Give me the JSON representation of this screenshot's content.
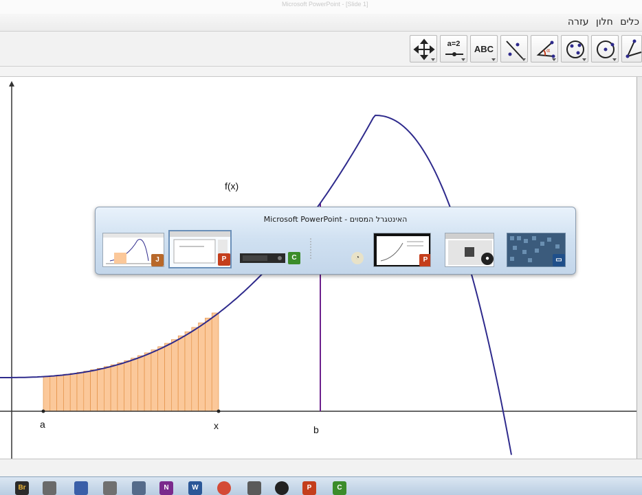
{
  "window": {
    "title": "Microsoft PowerPoint - [Slide 1]"
  },
  "menubar": {
    "items": [
      "כלים",
      "חלון",
      "עזרה"
    ]
  },
  "toolbar": {
    "tools": [
      {
        "name": "move-graphics-view-tool",
        "icon": "move-arrows-icon",
        "text": ""
      },
      {
        "name": "slider-tool",
        "icon": "slider-icon",
        "text": "a=2"
      },
      {
        "name": "text-tool",
        "icon": "text-icon",
        "text": "ABC"
      },
      {
        "name": "reflect-line-tool",
        "icon": "reflect-about-line-icon",
        "text": ""
      },
      {
        "name": "angle-tool",
        "icon": "angle-icon",
        "text": ""
      },
      {
        "name": "conic-tool",
        "icon": "conic-through-points-icon",
        "text": ""
      },
      {
        "name": "circle-tool",
        "icon": "circle-with-center-icon",
        "text": ""
      },
      {
        "name": "polygon-tool",
        "icon": "polygon-icon",
        "text": ""
      }
    ]
  },
  "graph": {
    "function_label": "f(x)",
    "point_labels": {
      "a": "a",
      "x": "x",
      "b": "b"
    },
    "colors": {
      "curve": "#2e2a8c",
      "line_b": "#6b1f8c",
      "bars_fill": "#fbc89a",
      "bars_stroke": "#e08a3c",
      "axis": "#333333"
    },
    "riemann_bar_count": 26
  },
  "task_switcher": {
    "title": "Microsoft PowerPoint - האינטגרל המסוים",
    "windows": [
      {
        "name": "geogebra-window-thumb",
        "badge": "java-icon",
        "selected": false
      },
      {
        "name": "powerpoint-window-thumb",
        "badge": "powerpoint-icon",
        "selected": true
      },
      {
        "name": "camtasia-recorder-thumb",
        "badge": "camtasia-icon",
        "selected": false
      },
      {
        "name": "blank-window-thumb",
        "badge": "",
        "selected": false
      },
      {
        "name": "app-window-thumb",
        "badge": "clock-app-icon",
        "selected": false
      },
      {
        "name": "powerpoint-slide-thumb",
        "badge": "powerpoint-icon",
        "selected": false
      },
      {
        "name": "media-window-thumb",
        "badge": "media-icon",
        "selected": false
      },
      {
        "name": "desktop-thumb",
        "badge": "desktop-icon",
        "selected": false
      }
    ]
  },
  "taskbar": {
    "icons": [
      {
        "name": "bridge-icon",
        "text": "Br",
        "color": "#2b2b2b"
      },
      {
        "name": "paint-app-icon",
        "text": "",
        "color": "#6a6a6a"
      },
      {
        "name": "checkmark-app-icon",
        "text": "",
        "color": "#3a5fa8"
      },
      {
        "name": "gear-app-icon",
        "text": "",
        "color": "#707070"
      },
      {
        "name": "writing-app-icon",
        "text": "",
        "color": "#556b8a"
      },
      {
        "name": "onenote-icon",
        "text": "N",
        "color": "#7a2a8c"
      },
      {
        "name": "word-icon",
        "text": "W",
        "color": "#2b5797"
      },
      {
        "name": "chrome-icon",
        "text": "",
        "color": "#d44a36"
      },
      {
        "name": "tools-app-icon",
        "text": "",
        "color": "#5a5a5a"
      },
      {
        "name": "media-player-icon",
        "text": "",
        "color": "#222222"
      },
      {
        "name": "powerpoint-taskbar-icon",
        "text": "P",
        "color": "#c43e1c"
      },
      {
        "name": "camtasia-taskbar-icon",
        "text": "C",
        "color": "#3b8c2a"
      }
    ]
  }
}
